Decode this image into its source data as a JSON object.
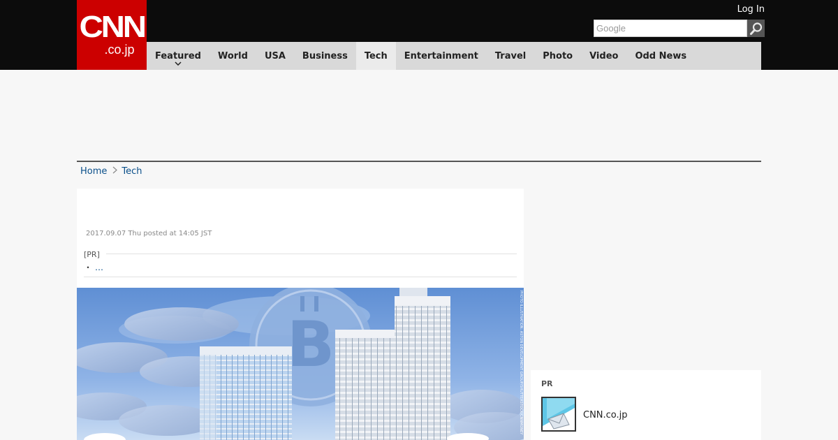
{
  "header": {
    "logo_main": "CNN",
    "logo_sub": ".co.jp",
    "login_label": "Log In",
    "search_placeholder": "Google",
    "search_icon": "magnifier-icon"
  },
  "nav": {
    "items": [
      {
        "label": "Featured",
        "has_dropdown": true
      },
      {
        "label": "World"
      },
      {
        "label": "USA"
      },
      {
        "label": "Business"
      },
      {
        "label": "Tech",
        "active": true
      },
      {
        "label": "Entertainment"
      },
      {
        "label": "Travel"
      },
      {
        "label": "Photo"
      },
      {
        "label": "Video"
      },
      {
        "label": "Odd News"
      }
    ],
    "dropdown_icon": "chevron-down-icon"
  },
  "breadcrumb": {
    "home": "Home",
    "current": "Tech",
    "separator_icon": "chevron-right-icon"
  },
  "article": {
    "posted": "2017.09.07 Thu posted at 14:05 JST",
    "pr_label": "[PR]",
    "pr_bullet": "・",
    "pr_link": "…",
    "hero_caption": "PHOTO ILLUSTRATION: ASTON DEVELOPMENT GROUP/SHUTTERSTOCK/CNNMONEY"
  },
  "sidebar": {
    "pr_label": "PR",
    "pr_item_title": "CNN.co.jp"
  },
  "colors": {
    "brand_red": "#cc0000",
    "topbar": "#0c0c0c",
    "nav_bg": "#d9d9d9",
    "link": "#0a4f8a"
  }
}
